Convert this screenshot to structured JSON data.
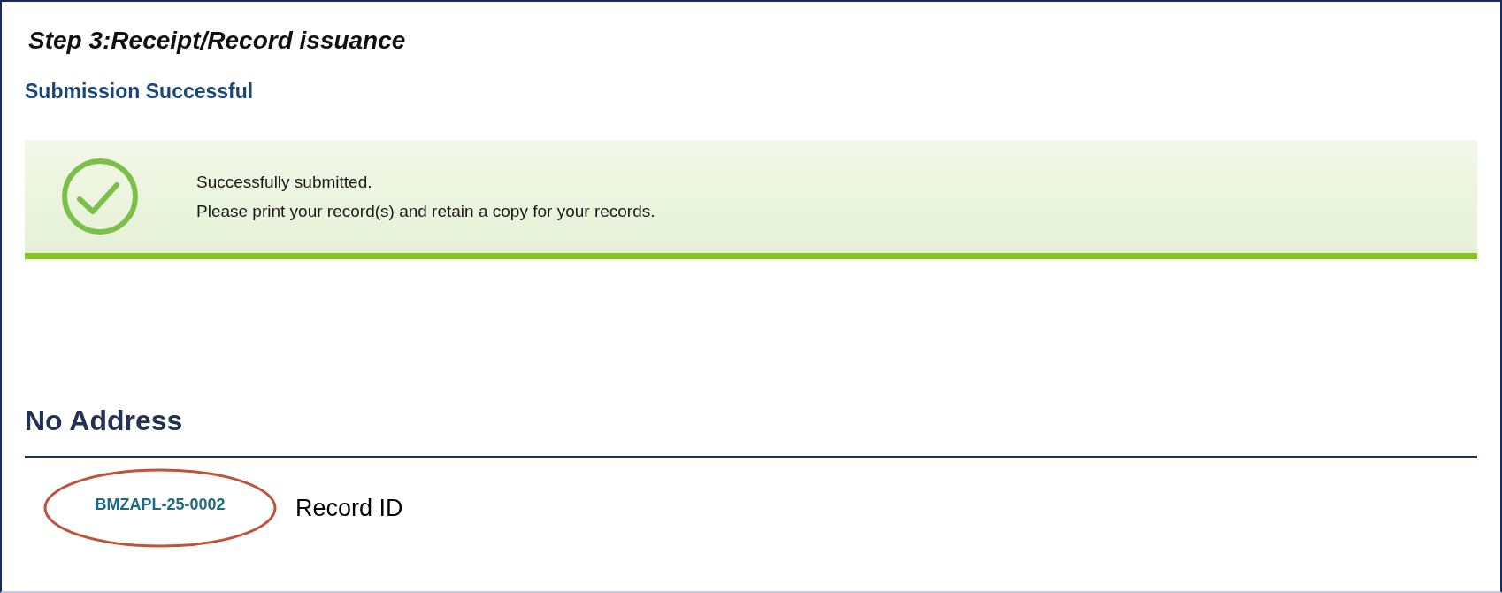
{
  "step_title": "Step 3:Receipt/Record issuance",
  "status_heading": "Submission Successful",
  "success_banner": {
    "lines": [
      "Successfully submitted.",
      "Please print your record(s) and retain a copy for your records."
    ]
  },
  "section_heading": "No Address",
  "record": {
    "id_link": "BMZAPL-25-0002",
    "annotation": "Record ID"
  }
}
